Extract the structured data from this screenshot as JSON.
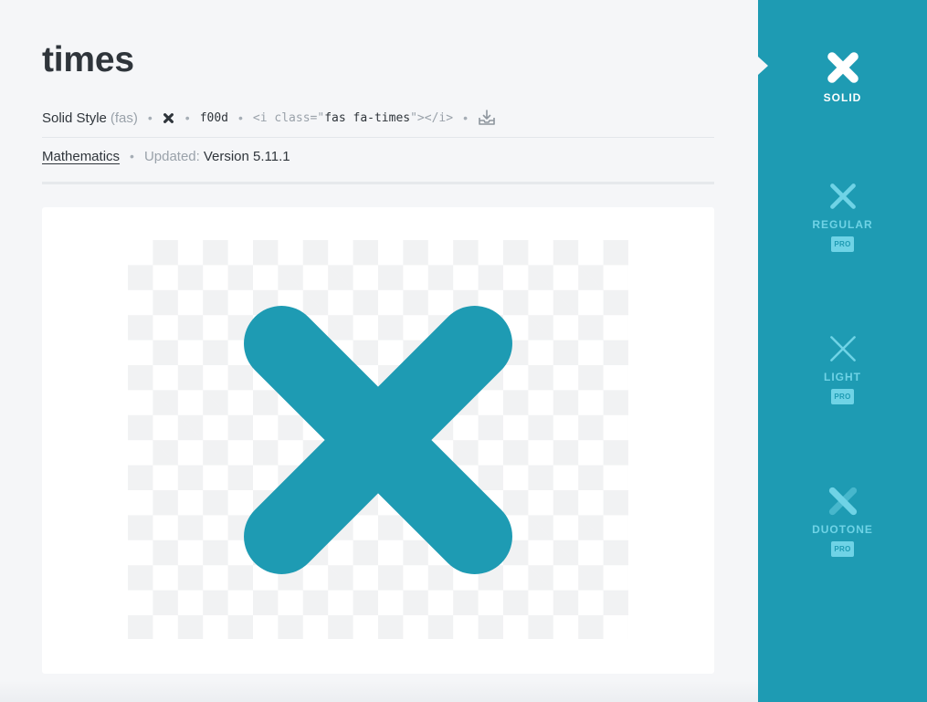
{
  "icon": {
    "name": "times",
    "style_label": "Solid Style",
    "style_abbr": "(fas)",
    "unicode": "f00d",
    "snippet": {
      "open": "<i class=\"",
      "classes": "fas fa-times",
      "close": "\"></i>"
    },
    "category": "Mathematics",
    "updated_label": "Updated:",
    "version": "Version 5.11.1",
    "glyph": "times-icon",
    "color": "#1e9bb3"
  },
  "styles": [
    {
      "label": "SOLID",
      "badge": "",
      "active": true,
      "icon": "times-solid-icon"
    },
    {
      "label": "REGULAR",
      "badge": "PRO",
      "active": false,
      "icon": "times-regular-icon"
    },
    {
      "label": "LIGHT",
      "badge": "PRO",
      "active": false,
      "icon": "times-light-icon"
    },
    {
      "label": "DUOTONE",
      "badge": "PRO",
      "active": false,
      "icon": "times-duotone-icon"
    }
  ],
  "colors": {
    "accent": "#1e9bb3",
    "accent_light": "#6fd3e6",
    "background": "#f5f6f8",
    "text": "#2f353b",
    "muted": "#9aa2aa"
  }
}
